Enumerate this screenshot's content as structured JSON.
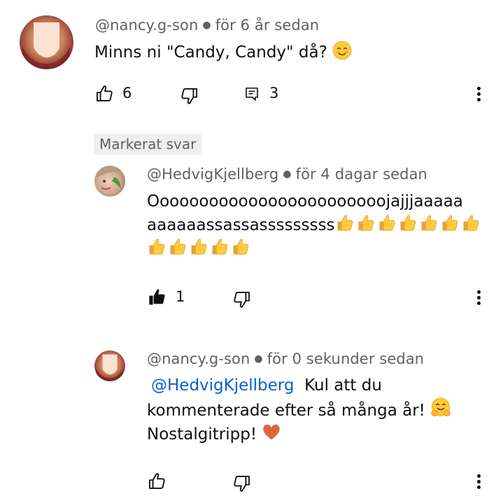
{
  "comment": {
    "author": "@nancy.g-son",
    "time": "för 6 år sedan",
    "text": "Minns ni \"Candy, Candy\" då?",
    "like_count": "6",
    "reply_count": "3"
  },
  "badge": "Markerat svar",
  "reply1": {
    "author": "@HedvigKjellberg",
    "time": "för 4 dagar sedan",
    "line1": "Oooooooooooooooooooooooojajjjaaaaa",
    "line2": "aaaaaassassasssssssss",
    "like_count": "1"
  },
  "reply2": {
    "author": "@nancy.g-son",
    "time": "för 0 sekunder sedan",
    "mention": "@HedvigKjellberg",
    "line1": "Kul att du",
    "line2": "kommenterade efter så många år!",
    "line3": "Nostalgitripp!"
  },
  "colors": {
    "meta": "#606060",
    "mention": "#065fd4",
    "badge_bg": "#efefef",
    "text": "#0f0f0f"
  },
  "icons": [
    "thumbs-up-icon",
    "thumbs-down-icon",
    "reply-icon",
    "more-vert-icon",
    "smile-emoji",
    "thumbs-up-emoji",
    "hug-emoji",
    "heart-emoji"
  ]
}
